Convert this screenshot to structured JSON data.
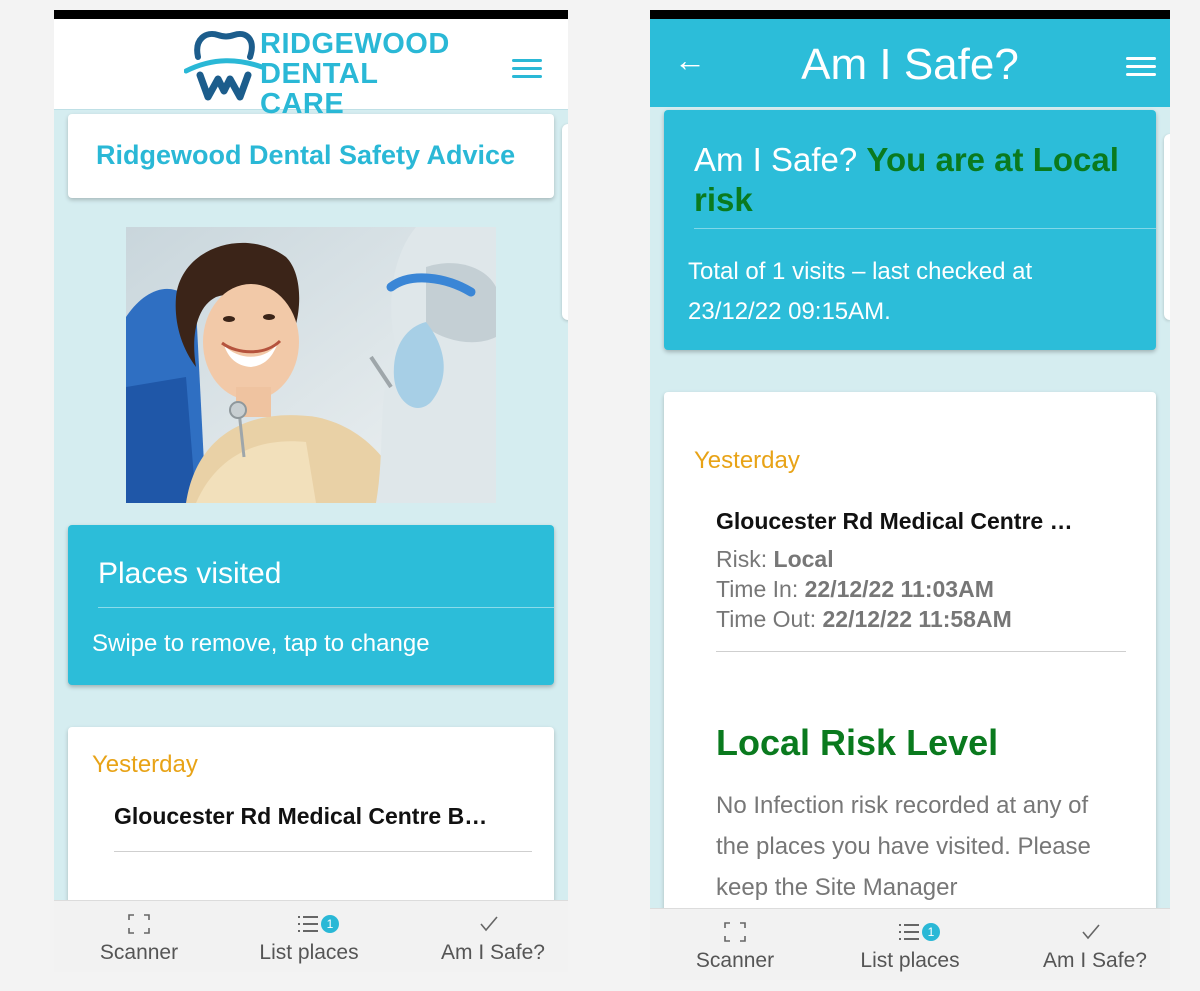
{
  "left": {
    "logo": {
      "line1": "RIDGEWOOD",
      "line2": "DENTAL CARE"
    },
    "advice_title": "Ridgewood Dental Safety Advice",
    "places": {
      "title": "Places visited",
      "subtitle": "Swipe to remove, tap to change"
    },
    "list": {
      "day": "Yesterday",
      "place": "Gloucester Rd Medical Centre B…"
    },
    "nav": {
      "scanner": "Scanner",
      "list_places": "List places",
      "am_i_safe": "Am I Safe?",
      "badge": "1"
    }
  },
  "right": {
    "header_title": "Am I Safe?",
    "safe_card": {
      "prefix": "Am I Safe?",
      "status": "You are at Local risk",
      "info": "Total of 1 visits – last checked at 23/12/22 09:15AM."
    },
    "detail": {
      "day": "Yesterday",
      "place": "Gloucester Rd Medical Centre …",
      "risk_label": "Risk:",
      "risk_value": "Local",
      "time_in_label": "Time In:",
      "time_in_value": "22/12/22 11:03AM",
      "time_out_label": "Time Out:",
      "time_out_value": "22/12/22 11:58AM",
      "risk_heading": "Local Risk Level",
      "risk_text": "No Infection risk recorded at any of the places you have visited. Please keep the Site Manager"
    },
    "nav": {
      "scanner": "Scanner",
      "list_places": "List places",
      "am_i_safe": "Am I Safe?",
      "badge": "1"
    }
  },
  "colors": {
    "brand_teal": "#2cbdd9",
    "accent_orange": "#e8a317",
    "risk_green": "#0a7a1e",
    "background": "#d5edf0"
  },
  "icons": [
    "tooth-logo-icon",
    "menu-icon",
    "back-arrow-icon",
    "scanner-icon",
    "list-icon",
    "check-icon"
  ]
}
